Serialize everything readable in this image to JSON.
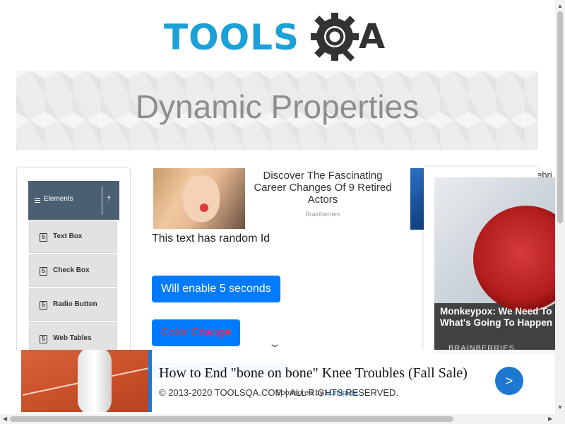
{
  "header": {
    "logo_text_left": "TOOLS",
    "logo_text_right": "A",
    "brand_colors": {
      "blue": "#1ba0d8",
      "dark": "#333333"
    }
  },
  "banner": {
    "title": "Dynamic Properties"
  },
  "sidebar": {
    "group_label": "Elements",
    "group_icon": "hamburger-icon",
    "toggle_icon": "arrow-up-icon",
    "items": [
      {
        "label": "Text Box",
        "icon": "html5-icon"
      },
      {
        "label": "Check Box",
        "icon": "html5-icon"
      },
      {
        "label": "Radio Button",
        "icon": "html5-icon"
      },
      {
        "label": "Web Tables",
        "icon": "html5-icon"
      }
    ]
  },
  "ad_top": {
    "title": "Discover The Fascinating Career Changes Of 9 Retired Actors",
    "brand": "Brainberries",
    "second_brand_fragment": "ebri"
  },
  "main": {
    "random_text": "This text has random Id",
    "enable_button": "Will enable 5 seconds",
    "color_button": "Color Change",
    "color_button_text_color": "#dc3545",
    "button_color": "#007bff"
  },
  "popup_ad": {
    "headline": "Monkeypox: We Need To What's Going To Happen",
    "brand": "BRAINBERRIES"
  },
  "bottom_ad": {
    "title": "How to End \"bone on bone\" Knee Troubles (Fall Sale)",
    "sponsor_prefix": "Sponsored by",
    "sponsor_name": "Lumipure",
    "go_label": ">"
  },
  "footer": {
    "copyright": "© 2013-2020 TOOLSQA.COM | ALL RIGHTS RESERVED."
  },
  "scrollbar": {
    "up": "▲",
    "down": "▼",
    "left": "◀",
    "right": "▶"
  }
}
